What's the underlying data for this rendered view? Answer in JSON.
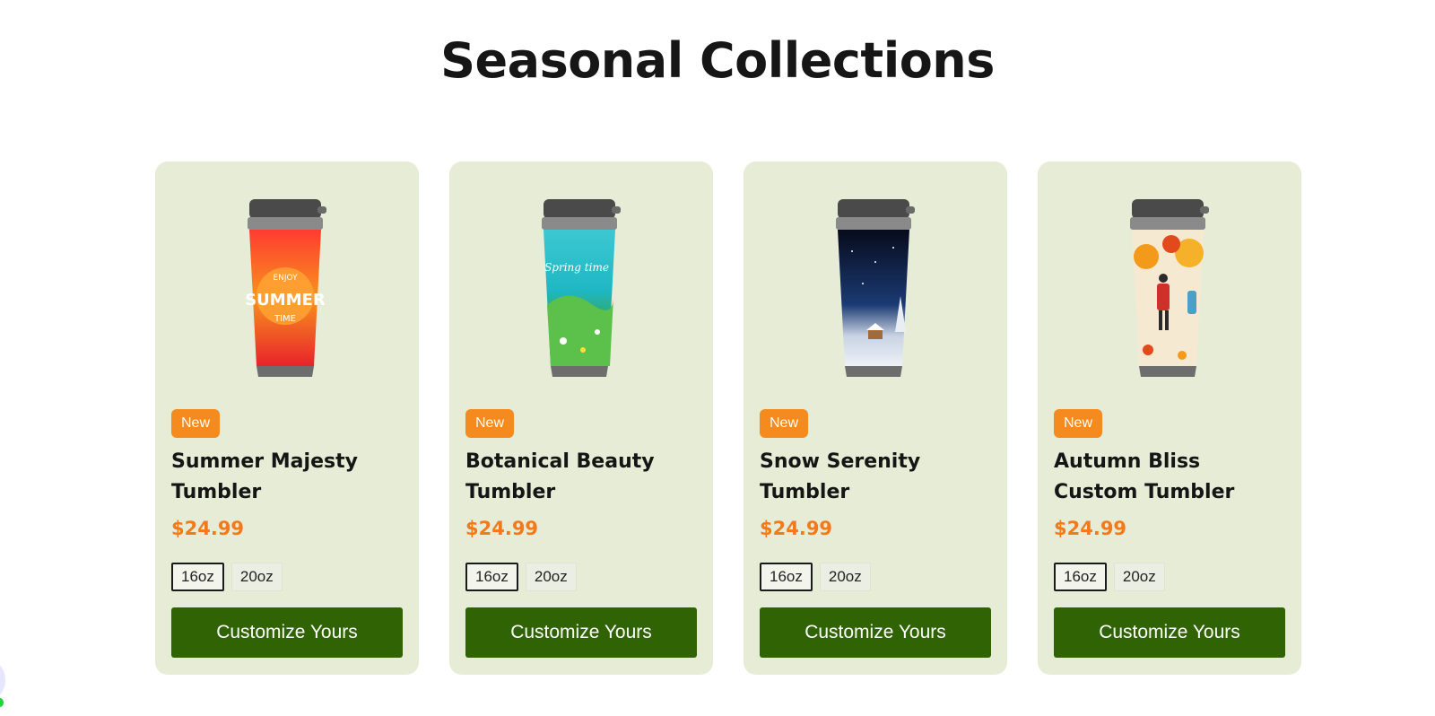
{
  "section": {
    "title": "Seasonal Collections"
  },
  "products": [
    {
      "badge": "New",
      "name": "Summer Majesty Tumbler",
      "price": "$24.99",
      "sizes": [
        "16oz",
        "20oz"
      ],
      "selected_size": "16oz",
      "cta": "Customize Yours",
      "image": {
        "print_text": [
          "ENJOY",
          "SUMMER",
          "TIME"
        ],
        "colors": [
          "#e8232b",
          "#f7931e",
          "#ff6a2a"
        ]
      }
    },
    {
      "badge": "New",
      "name": "Botanical Beauty Tumbler",
      "price": "$24.99",
      "sizes": [
        "16oz",
        "20oz"
      ],
      "selected_size": "16oz",
      "cta": "Customize Yours",
      "image": {
        "print_text": [
          "Spring time"
        ],
        "colors": [
          "#1fb7c4",
          "#3aa24a",
          "#6bd05a"
        ]
      }
    },
    {
      "badge": "New",
      "name": "Snow Serenity Tumbler",
      "price": "$24.99",
      "sizes": [
        "16oz",
        "20oz"
      ],
      "selected_size": "16oz",
      "cta": "Customize Yours",
      "image": {
        "print_text": [],
        "colors": [
          "#0b1024",
          "#1b3a73",
          "#dfe5ef"
        ]
      }
    },
    {
      "badge": "New",
      "name": "Autumn Bliss Custom Tumbler",
      "price": "$24.99",
      "sizes": [
        "16oz",
        "20oz"
      ],
      "selected_size": "16oz",
      "cta": "Customize Yours",
      "image": {
        "print_text": [],
        "colors": [
          "#f6e9d2",
          "#f39a1b",
          "#e24a1c"
        ]
      }
    }
  ],
  "colors": {
    "card_bg": "#e6ecd6",
    "badge_bg": "#f58a1f",
    "price": "#f3791b",
    "cta_bg": "#2f6303"
  }
}
